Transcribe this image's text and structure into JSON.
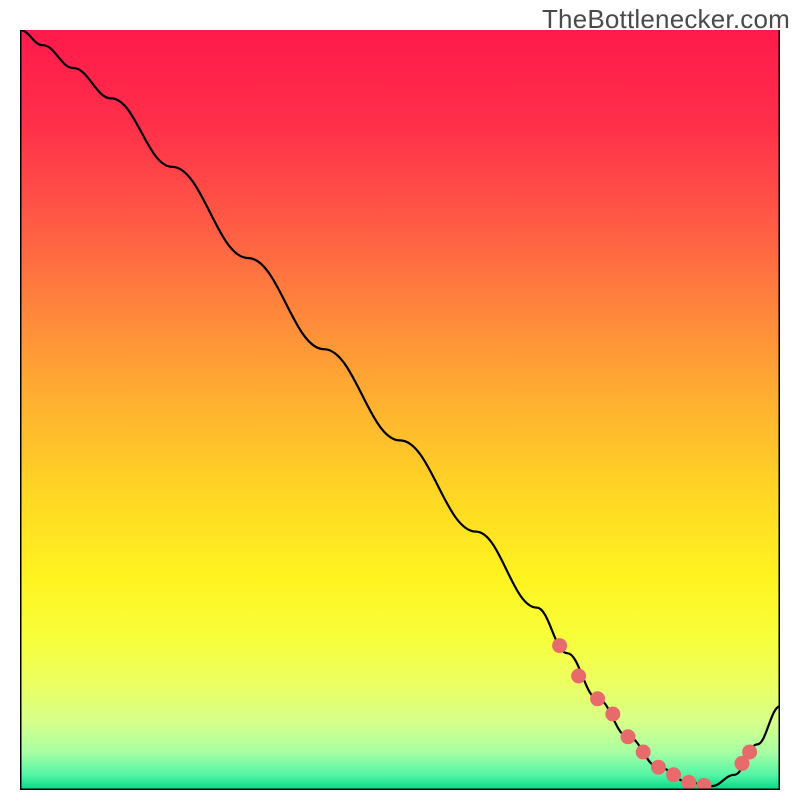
{
  "header": {
    "watermark": "TheBottlenecker.com"
  },
  "colors": {
    "gradient_stops": [
      {
        "offset": 0.0,
        "color": "#ff1a4b"
      },
      {
        "offset": 0.12,
        "color": "#ff2e4a"
      },
      {
        "offset": 0.25,
        "color": "#ff5945"
      },
      {
        "offset": 0.38,
        "color": "#ff8a3b"
      },
      {
        "offset": 0.5,
        "color": "#ffb42f"
      },
      {
        "offset": 0.62,
        "color": "#ffd923"
      },
      {
        "offset": 0.72,
        "color": "#fff320"
      },
      {
        "offset": 0.8,
        "color": "#f7ff3a"
      },
      {
        "offset": 0.86,
        "color": "#ecff62"
      },
      {
        "offset": 0.91,
        "color": "#d7ff89"
      },
      {
        "offset": 0.95,
        "color": "#a8ffa3"
      },
      {
        "offset": 0.98,
        "color": "#55f5a6"
      },
      {
        "offset": 1.0,
        "color": "#00d884"
      }
    ],
    "curve": "#000000",
    "dots": "#e86b6b",
    "frame": "#000000"
  },
  "chart_data": {
    "type": "line",
    "title": "",
    "xlabel": "",
    "ylabel": "",
    "xlim": [
      0,
      100
    ],
    "ylim": [
      0,
      100
    ],
    "grid": false,
    "legend": false,
    "series": [
      {
        "name": "bottleneck-curve",
        "x": [
          0,
          3,
          7,
          12,
          20,
          30,
          40,
          50,
          60,
          68,
          72,
          76,
          80,
          84,
          88,
          91,
          94,
          97,
          100
        ],
        "y": [
          100,
          98,
          95,
          91,
          82,
          70,
          58,
          46,
          34,
          24,
          18,
          12,
          7,
          3,
          1,
          0.5,
          2,
          6,
          11
        ]
      }
    ],
    "markers": [
      {
        "name": "trough-dots",
        "x": [
          71,
          73.5,
          76,
          78,
          80,
          82,
          84,
          86,
          88,
          90,
          95,
          96
        ],
        "y": [
          19,
          15,
          12,
          10,
          7,
          5,
          3,
          2,
          1,
          0.6,
          3.5,
          5
        ]
      }
    ]
  }
}
